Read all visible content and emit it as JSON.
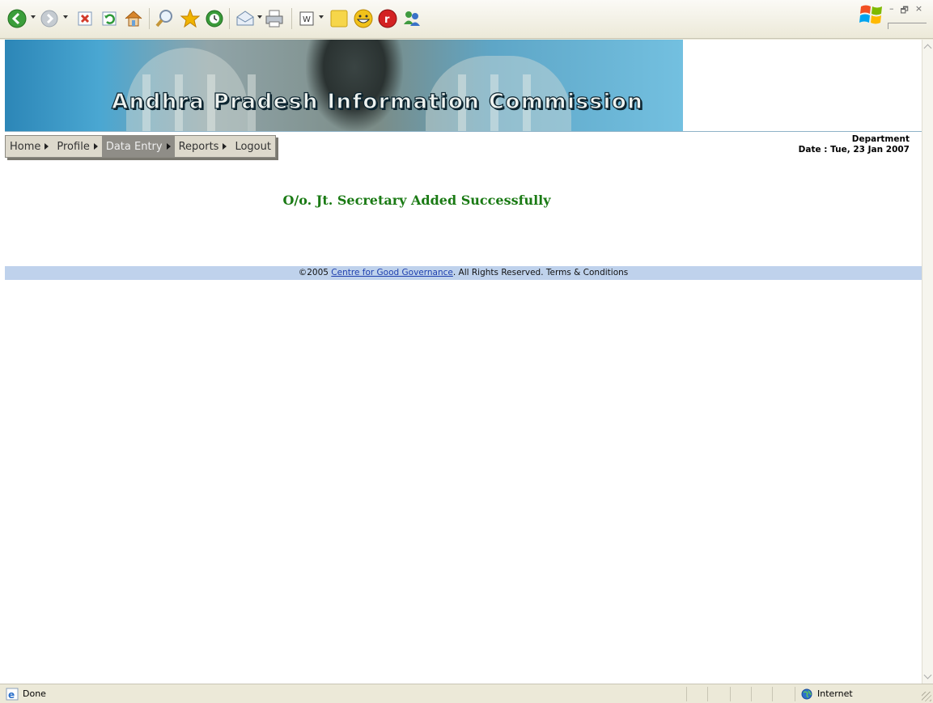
{
  "window": {
    "controls": [
      "–",
      "🗗",
      "×"
    ]
  },
  "toolbar": {
    "buttons": [
      {
        "name": "back",
        "icon": "back-arrow-icon",
        "color": "#3b9e3b"
      },
      {
        "name": "forward",
        "icon": "forward-arrow-icon",
        "color": "#9aa3ad"
      },
      {
        "name": "stop",
        "icon": "stop-icon",
        "color": "#d23a2a"
      },
      {
        "name": "refresh",
        "icon": "refresh-icon",
        "color": "#2f9a3a"
      },
      {
        "name": "home",
        "icon": "home-icon",
        "color": "#d8862c"
      },
      {
        "name": "search",
        "icon": "search-icon"
      },
      {
        "name": "favorites",
        "icon": "star-icon",
        "color": "#f0b400"
      },
      {
        "name": "history",
        "icon": "history-icon",
        "color": "#3a9a3a"
      },
      {
        "name": "mail",
        "icon": "mail-icon"
      },
      {
        "name": "print",
        "icon": "print-icon"
      },
      {
        "name": "edit",
        "icon": "word-edit-icon"
      },
      {
        "name": "notes",
        "icon": "sticky-note-icon",
        "color": "#f6d64a"
      },
      {
        "name": "messenger",
        "icon": "smiley-icon",
        "color": "#f2c21a"
      },
      {
        "name": "research",
        "icon": "red-circle-icon",
        "color": "#d32222"
      },
      {
        "name": "contacts",
        "icon": "people-icon"
      }
    ]
  },
  "banner": {
    "title": "Andhra Pradesh Information Commission"
  },
  "nav": {
    "items": [
      {
        "label": "Home",
        "active": false
      },
      {
        "label": "Profile",
        "active": false
      },
      {
        "label": "Data Entry",
        "active": true
      },
      {
        "label": "Reports",
        "active": false
      },
      {
        "label": "Logout",
        "active": false
      }
    ]
  },
  "header_info": {
    "department": "Department",
    "date": "Date : Tue, 23 Jan 2007"
  },
  "message": {
    "text": "O/o. Jt. Secretary Added Successfully",
    "color": "#1a7a14"
  },
  "footer": {
    "prefix": "©2005 ",
    "link_text": "Centre for Good Governance",
    "suffix": ". All Rights Reserved. Terms & Conditions"
  },
  "statusbar": {
    "status": "Done",
    "zone": "Internet"
  }
}
